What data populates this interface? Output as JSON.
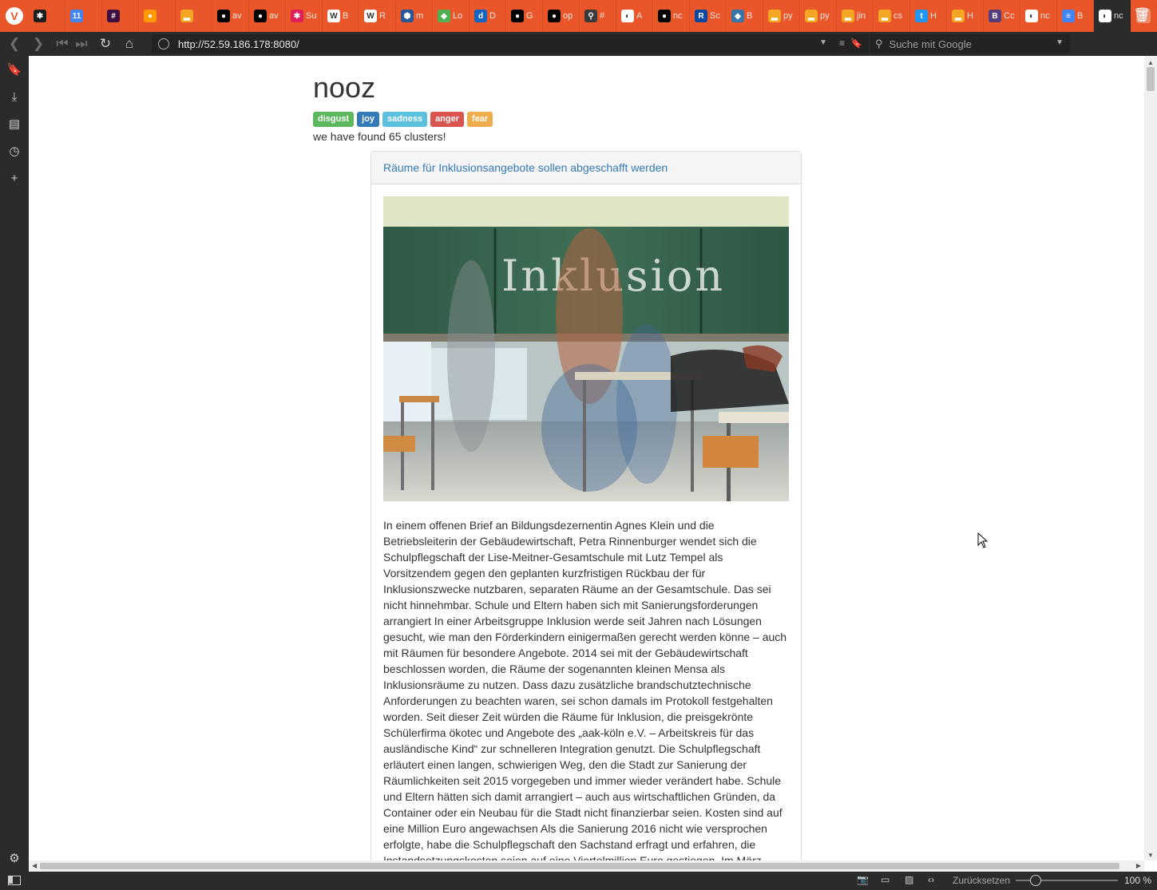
{
  "browser": {
    "tabs": [
      {
        "title": "",
        "icon": "vivaldi-community-icon",
        "color": "#1d1d1d",
        "glyph": "✱"
      },
      {
        "title": "",
        "icon": "calendar-icon",
        "color": "#4285f4",
        "glyph": "11"
      },
      {
        "title": "",
        "icon": "slack-icon",
        "color": "#3f0e40",
        "glyph": "#"
      },
      {
        "title": "",
        "icon": "orange-dot-icon",
        "color": "#ff9900",
        "glyph": "●"
      },
      {
        "title": "",
        "icon": "chart-icon",
        "color": "#f5a623",
        "glyph": "▂"
      },
      {
        "title": "av",
        "icon": "github-icon",
        "color": "#000000",
        "glyph": "●"
      },
      {
        "title": "av",
        "icon": "github-icon",
        "color": "#000000",
        "glyph": "●"
      },
      {
        "title": "Su",
        "icon": "slack-color-icon",
        "color": "#e01e5a",
        "glyph": "✱"
      },
      {
        "title": "B",
        "icon": "wikipedia-icon",
        "color": "#ffffff",
        "glyph": "W"
      },
      {
        "title": "R",
        "icon": "wikipedia-icon",
        "color": "#ffffff",
        "glyph": "W"
      },
      {
        "title": "m",
        "icon": "shield-icon",
        "color": "#2b5797",
        "glyph": "⬢"
      },
      {
        "title": "Lo",
        "icon": "lo-icon",
        "color": "#4caf50",
        "glyph": "◆"
      },
      {
        "title": "D",
        "icon": "dict-icon",
        "color": "#1565c0",
        "glyph": "d"
      },
      {
        "title": "G",
        "icon": "github-icon",
        "color": "#000000",
        "glyph": "●"
      },
      {
        "title": "op",
        "icon": "github-icon",
        "color": "#000000",
        "glyph": "●"
      },
      {
        "title": "#",
        "icon": "pin-icon",
        "color": "#3a3a3a",
        "glyph": "⚲"
      },
      {
        "title": "A",
        "icon": "globe-icon",
        "color": "#ffffff",
        "glyph": "◐"
      },
      {
        "title": "nc",
        "icon": "github-icon",
        "color": "#000000",
        "glyph": "●"
      },
      {
        "title": "Sc",
        "icon": "br-icon",
        "color": "#0d47a1",
        "glyph": "R"
      },
      {
        "title": "B",
        "icon": "python-icon",
        "color": "#3776ab",
        "glyph": "◆"
      },
      {
        "title": "py",
        "icon": "chart-icon",
        "color": "#f5a623",
        "glyph": "▂"
      },
      {
        "title": "py",
        "icon": "chart-icon",
        "color": "#f5a623",
        "glyph": "▂"
      },
      {
        "title": "jin",
        "icon": "chart-icon",
        "color": "#f5a623",
        "glyph": "▂"
      },
      {
        "title": "cs",
        "icon": "chart-icon",
        "color": "#f5a623",
        "glyph": "▂"
      },
      {
        "title": "H",
        "icon": "t-icon",
        "color": "#2196f3",
        "glyph": "t"
      },
      {
        "title": "H",
        "icon": "chart-icon",
        "color": "#f5a623",
        "glyph": "▂"
      },
      {
        "title": "Cc",
        "icon": "bootstrap-icon",
        "color": "#563d7c",
        "glyph": "B"
      },
      {
        "title": "nc",
        "icon": "globe-icon",
        "color": "#ffffff",
        "glyph": "◐"
      },
      {
        "title": "B",
        "icon": "docs-icon",
        "color": "#4285f4",
        "glyph": "≡"
      },
      {
        "title": "nc",
        "icon": "globe-icon",
        "color": "#ffffff",
        "glyph": "◐",
        "active": true
      }
    ],
    "url": "http://52.59.186.178:8080/",
    "search_placeholder": "Suche mit Google",
    "status": {
      "reset_label": "Zurücksetzen",
      "zoom": "100 %"
    }
  },
  "page": {
    "title": "nooz",
    "labels": [
      {
        "text": "disgust",
        "kind": "disgust"
      },
      {
        "text": "joy",
        "kind": "joy"
      },
      {
        "text": "sadness",
        "kind": "sadness"
      },
      {
        "text": "anger",
        "kind": "anger"
      },
      {
        "text": "fear",
        "kind": "fear"
      }
    ],
    "found_text": "we have found 65 clusters!",
    "article": {
      "headline": "Räume für Inklusionsangebote sollen abgeschafft werden",
      "image_chalk_text": "Inklusion",
      "body": "In einem offenen Brief an Bildungsdezernentin Agnes Klein und die Betriebsleiterin der Gebäudewirtschaft, Petra Rinnenburger wendet sich die Schulpflegschaft der Lise-Meitner-Gesamtschule mit Lutz Tempel als Vorsitzendem gegen den geplanten kurzfristigen Rückbau der für Inklusionszwecke nutzbaren, separaten Räume an der Gesamtschule. Das sei nicht hinnehmbar. Schule und Eltern haben sich mit Sanierungsforderungen arrangiert In einer Arbeitsgruppe Inklusion werde seit Jahren nach Lösungen gesucht, wie man den Förderkindern einigermaßen gerecht werden könne – auch mit Räumen für besondere Angebote. 2014 sei mit der Gebäudewirtschaft beschlossen worden, die Räume der sogenannten kleinen Mensa als Inklusionsräume zu nutzen. Dass dazu zusätzliche brandschutztechnische Anforderungen zu beachten waren, sei schon damals im Protokoll festgehalten worden. Seit dieser Zeit würden die Räume für Inklusion, die preisgekrönte Schülerfirma ökotec und Angebote des „aak-köln e.V. – Arbeitskreis für das ausländische Kind“ zur schnelleren Integration genutzt. Die Schulpflegschaft erläutert einen langen, schwierigen Weg, den die Stadt zur Sanierung der Räumlichkeiten seit 2015 vorgegeben und immer wieder verändert habe. Schule und Eltern hätten sich damit arrangiert – auch aus wirtschaftlichen Gründen, da Container oder ein Neubau für die Stadt nicht finanzierbar seien. Kosten sind auf eine Million Euro angewachsen Als die Sanierung 2016 nicht wie versprochen erfolgte, habe die Schulpflegschaft den Sachstand erfragt und erfahren, die Instandsetzungskosten seien auf eine Viertelmillion Euro gestiegen. Im März"
    }
  },
  "colors": {
    "tabbar": "#e8562a",
    "chrome": "#2b2b2b",
    "link": "#337ab7",
    "disgust": "#5cb85c",
    "joy": "#337ab7",
    "sadness": "#5bc0de",
    "anger": "#d9534f",
    "fear": "#f0ad4e"
  }
}
